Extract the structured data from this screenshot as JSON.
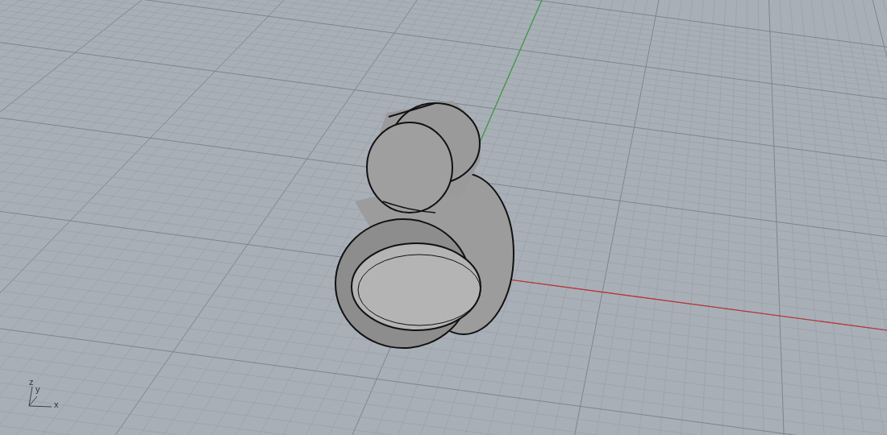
{
  "viewport": {
    "axis_widget": {
      "labels": [
        "z",
        "y",
        "x"
      ]
    }
  }
}
